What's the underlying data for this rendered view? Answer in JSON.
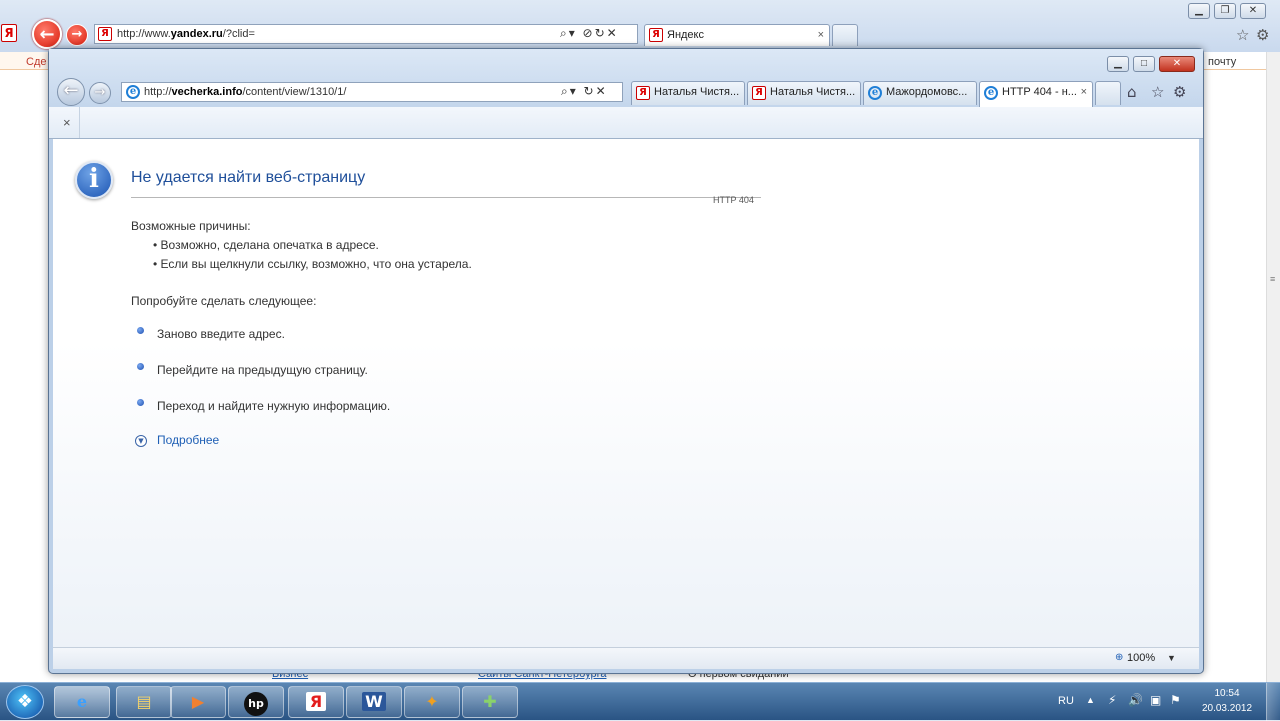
{
  "back_window": {
    "address": {
      "prefix": "http://www.",
      "domain": "yandex.ru",
      "suffix": "/?clid="
    },
    "tab": {
      "label": "Яндекс"
    },
    "left_edge_text": "Сде",
    "right_edge_text": "почту",
    "bottom_link_1": "Бизнес",
    "bottom_link_2": "Сайты Санкт-Петербурга",
    "bottom_text_3": "О первом свидании"
  },
  "front_window": {
    "address": {
      "prefix": "http://",
      "domain": "vecherka.info",
      "suffix": "/content/view/1310/1/"
    },
    "tabs": [
      {
        "label": "Наталья Чистя...",
        "icon": "yandex-icon",
        "active": false
      },
      {
        "label": "Наталья Чистя...",
        "icon": "yandex-icon",
        "active": false
      },
      {
        "label": "Мажордомовс...",
        "icon": "ie-icon",
        "active": false
      },
      {
        "label": "HTTP 404 - н...",
        "icon": "ie-icon",
        "active": true
      }
    ],
    "cmd_close": "×",
    "zoom": "100%"
  },
  "error_page": {
    "title": "Не удается найти веб-страницу",
    "code": "HTTP 404",
    "causes_heading": "Возможные причины:",
    "causes": [
      "•  Возможно, сделана опечатка в адресе.",
      "•  Если вы щелкнули ссылку, возможно, что она устарела."
    ],
    "try_heading": "Попробуйте сделать следующее:",
    "actions": [
      "Заново введите адрес.",
      "Перейдите на предыдущую страницу.",
      "Переход   и найдите нужную информацию."
    ],
    "more_link": "Подробнее"
  },
  "taskbar": {
    "lang": "RU",
    "time": "10:54",
    "date": "20.03.2012"
  }
}
